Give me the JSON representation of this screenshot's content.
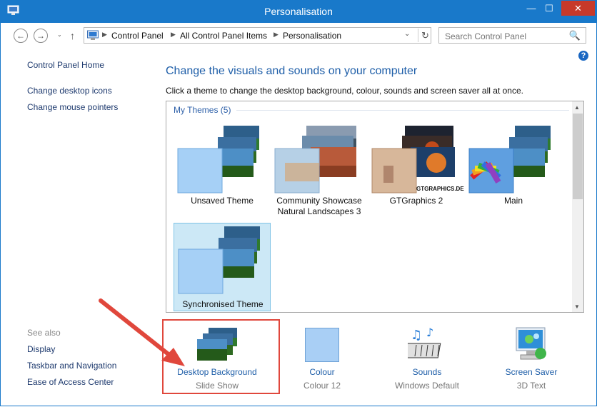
{
  "window": {
    "title": "Personalisation",
    "controls": {
      "minimize": "—",
      "maximize": "☐",
      "close": "✕"
    }
  },
  "nav": {
    "back": "←",
    "forward": "→",
    "recent": "⌄",
    "up": "↑",
    "breadcrumb": [
      "Control Panel",
      "All Control Panel Items",
      "Personalisation"
    ],
    "refresh": "↻",
    "search_placeholder": "Search Control Panel",
    "search_icon": "🔍",
    "help": "?"
  },
  "sidebar": {
    "links": [
      "Control Panel Home",
      "Change desktop icons",
      "Change mouse pointers"
    ],
    "see_also_label": "See also",
    "see_also": [
      "Display",
      "Taskbar and Navigation",
      "Ease of Access Center"
    ]
  },
  "main": {
    "heading": "Change the visuals and sounds on your computer",
    "subtext": "Click a theme to change the desktop background, colour, sounds and screen saver all at once.",
    "group_label": "My Themes (5)",
    "themes": [
      {
        "label": "Unsaved Theme",
        "selected": false
      },
      {
        "label": "Community Showcase Natural Landscapes 3",
        "line1": "Community Showcase",
        "line2": "Natural Landscapes 3",
        "selected": false
      },
      {
        "label": "GTGraphics 2",
        "watermark": "GTGRAPHICS.DE",
        "selected": false
      },
      {
        "label": "Main",
        "selected": false
      },
      {
        "label": "Synchronised Theme",
        "selected": true
      }
    ]
  },
  "panels": [
    {
      "title": "Desktop Background",
      "subtitle": "Slide Show"
    },
    {
      "title": "Colour",
      "subtitle": "Colour 12",
      "swatch": "#a9cff5"
    },
    {
      "title": "Sounds",
      "subtitle": "Windows Default"
    },
    {
      "title": "Screen Saver",
      "subtitle": "3D Text"
    }
  ],
  "colors": {
    "titlebar": "#1979ca",
    "close": "#c7392a",
    "link": "#1e5ea8",
    "selection": "#cce8f6",
    "annotation": "#e0473c"
  }
}
